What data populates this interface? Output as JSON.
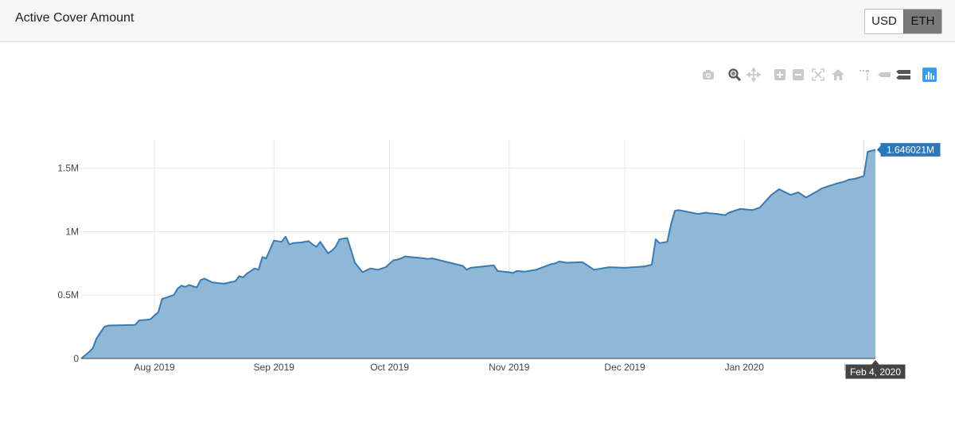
{
  "header": {
    "title": "Active Cover Amount",
    "currency_options": [
      "USD",
      "ETH"
    ],
    "selected_currency": "ETH"
  },
  "modebar": {
    "icons": [
      "camera-icon",
      "zoom-icon",
      "pan-icon",
      "zoom-in-icon",
      "zoom-out-icon",
      "autoscale-icon",
      "home-icon",
      "spike-lines-icon",
      "hover-closest-icon",
      "hover-compare-icon",
      "plotly-logo-icon"
    ]
  },
  "colors": {
    "line": "#3a7ab2",
    "fill": "#8fb7d6",
    "grid": "#e8e8e8",
    "hover_label": "#2e78b8",
    "axis_hover": "#444444"
  },
  "chart_data": {
    "type": "area",
    "title": "",
    "xlabel": "",
    "ylabel": "",
    "x_tick_labels": [
      "Aug 2019",
      "Sep 2019",
      "Oct 2019",
      "Nov 2019",
      "Dec 2019",
      "Jan 2020",
      "Feb 2020"
    ],
    "y_tick_labels": [
      "0",
      "0.5M",
      "1M",
      "1.5M"
    ],
    "y_tick_values": [
      0,
      500000,
      1000000,
      1500000
    ],
    "ylim": [
      0,
      1730000
    ],
    "xlim": [
      "2019-07-13",
      "2020-02-04"
    ],
    "grid": true,
    "series": [
      {
        "x": [
          "2019-07-13",
          "2019-07-15",
          "2019-07-16",
          "2019-07-17",
          "2019-07-19",
          "2019-07-20",
          "2019-07-27",
          "2019-07-28",
          "2019-07-30",
          "2019-07-31",
          "2019-08-01",
          "2019-08-02",
          "2019-08-03",
          "2019-08-04",
          "2019-08-06",
          "2019-08-07",
          "2019-08-08",
          "2019-08-09",
          "2019-08-10",
          "2019-08-12",
          "2019-08-13",
          "2019-08-14",
          "2019-08-16",
          "2019-08-19",
          "2019-08-22",
          "2019-08-23",
          "2019-08-24",
          "2019-08-25",
          "2019-08-26",
          "2019-08-27",
          "2019-08-28",
          "2019-08-29",
          "2019-08-30",
          "2019-09-01",
          "2019-09-03",
          "2019-09-04",
          "2019-09-05",
          "2019-09-06",
          "2019-09-08",
          "2019-09-10",
          "2019-09-11",
          "2019-09-12",
          "2019-09-13",
          "2019-09-15",
          "2019-09-16",
          "2019-09-17",
          "2019-09-18",
          "2019-09-20",
          "2019-09-22",
          "2019-09-24",
          "2019-09-26",
          "2019-09-28",
          "2019-09-30",
          "2019-10-02",
          "2019-10-03",
          "2019-10-04",
          "2019-10-05",
          "2019-10-10",
          "2019-10-11",
          "2019-10-12",
          "2019-10-20",
          "2019-10-21",
          "2019-10-22",
          "2019-10-28",
          "2019-10-29",
          "2019-11-01",
          "2019-11-02",
          "2019-11-03",
          "2019-11-05",
          "2019-11-08",
          "2019-11-12",
          "2019-11-13",
          "2019-11-14",
          "2019-11-16",
          "2019-11-20",
          "2019-11-21",
          "2019-11-23",
          "2019-11-26",
          "2019-11-27",
          "2019-12-01",
          "2019-12-06",
          "2019-12-08",
          "2019-12-09",
          "2019-12-10",
          "2019-12-12",
          "2019-12-13",
          "2019-12-14",
          "2019-12-15",
          "2019-12-20",
          "2019-12-22",
          "2019-12-23",
          "2019-12-25",
          "2019-12-27",
          "2019-12-28",
          "2019-12-31",
          "2020-01-03",
          "2020-01-05",
          "2020-01-08",
          "2020-01-10",
          "2020-01-13",
          "2020-01-15",
          "2020-01-16",
          "2020-01-17",
          "2020-01-20",
          "2020-01-21",
          "2020-01-22",
          "2020-01-25",
          "2020-01-27",
          "2020-01-28",
          "2020-01-30",
          "2020-01-31",
          "2020-02-01",
          "2020-02-02",
          "2020-02-04"
        ],
        "y": [
          0,
          50000,
          80000,
          160000,
          250000,
          260000,
          265000,
          300000,
          305000,
          310000,
          340000,
          365000,
          470000,
          480000,
          500000,
          550000,
          575000,
          565000,
          580000,
          560000,
          620000,
          630000,
          600000,
          590000,
          610000,
          650000,
          640000,
          670000,
          690000,
          710000,
          700000,
          800000,
          790000,
          930000,
          920000,
          960000,
          900000,
          910000,
          915000,
          925000,
          900000,
          880000,
          920000,
          830000,
          850000,
          880000,
          940000,
          950000,
          755000,
          680000,
          710000,
          700000,
          720000,
          775000,
          780000,
          790000,
          805000,
          790000,
          785000,
          790000,
          730000,
          700000,
          715000,
          735000,
          690000,
          680000,
          675000,
          690000,
          685000,
          700000,
          745000,
          750000,
          765000,
          755000,
          760000,
          740000,
          700000,
          715000,
          720000,
          715000,
          725000,
          740000,
          940000,
          910000,
          920000,
          1060000,
          1165000,
          1170000,
          1140000,
          1150000,
          1145000,
          1140000,
          1130000,
          1150000,
          1180000,
          1170000,
          1190000,
          1290000,
          1335000,
          1290000,
          1310000,
          1290000,
          1270000,
          1320000,
          1340000,
          1350000,
          1380000,
          1395000,
          1410000,
          1420000,
          1430000,
          1440000,
          1630000,
          1646021
        ]
      }
    ],
    "hover": {
      "value_label": "1.646021M",
      "date_label": "Feb 4, 2020"
    }
  }
}
